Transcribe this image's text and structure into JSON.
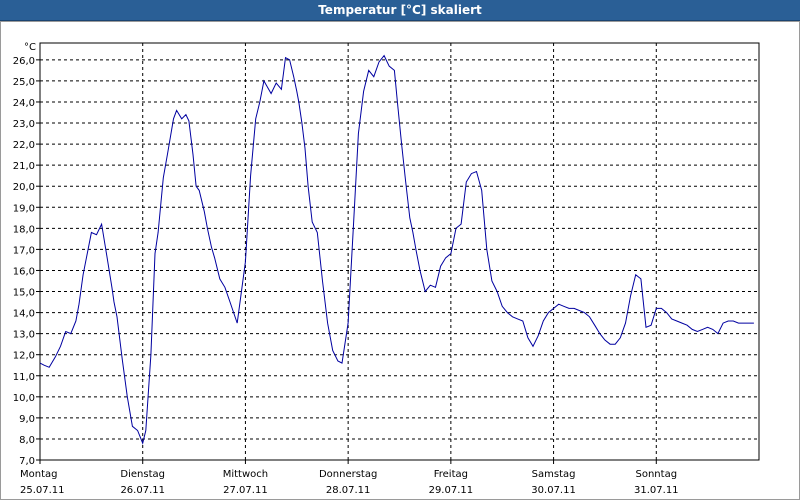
{
  "window": {
    "title": "Temperatur [°C] skaliert"
  },
  "chart_data": {
    "type": "line",
    "title": "Temperatur [°C] skaliert",
    "ylabel": "°C",
    "xlabel": "",
    "ylim": [
      7.0,
      26.8
    ],
    "xlim": [
      0,
      7
    ],
    "yticks": [
      "7,0",
      "8,0",
      "9,0",
      "10,0",
      "11,0",
      "12,0",
      "13,0",
      "14,0",
      "15,0",
      "16,0",
      "17,0",
      "18,0",
      "19,0",
      "20,0",
      "21,0",
      "22,0",
      "23,0",
      "24,0",
      "25,0",
      "26,0"
    ],
    "ytick_values": [
      7,
      8,
      9,
      10,
      11,
      12,
      13,
      14,
      15,
      16,
      17,
      18,
      19,
      20,
      21,
      22,
      23,
      24,
      25,
      26
    ],
    "days": [
      {
        "weekday": "Montag",
        "date": "25.07.11"
      },
      {
        "weekday": "Dienstag",
        "date": "26.07.11"
      },
      {
        "weekday": "Mittwoch",
        "date": "27.07.11"
      },
      {
        "weekday": "Donnerstag",
        "date": "28.07.11"
      },
      {
        "weekday": "Freitag",
        "date": "29.07.11"
      },
      {
        "weekday": "Samstag",
        "date": "30.07.11"
      },
      {
        "weekday": "Sonntag",
        "date": "31.07.11"
      }
    ],
    "grid": true,
    "line_color": "#0000a0",
    "series": [
      {
        "x": [
          0.0,
          0.04,
          0.09,
          0.15,
          0.2,
          0.25,
          0.3,
          0.35,
          0.38,
          0.42,
          0.5,
          0.55,
          0.6,
          0.65,
          0.7,
          0.72,
          0.75,
          0.8,
          0.85,
          0.9,
          0.95,
          1.0,
          1.03,
          1.08,
          1.12,
          1.15,
          1.2,
          1.24,
          1.3,
          1.33,
          1.38,
          1.42,
          1.45,
          1.49,
          1.52,
          1.55,
          1.6,
          1.63,
          1.67,
          1.7,
          1.75,
          1.8,
          1.85,
          1.92,
          2.0,
          2.05,
          2.1,
          2.14,
          2.18,
          2.25,
          2.3,
          2.35,
          2.39,
          2.43,
          2.47,
          2.5,
          2.52,
          2.55,
          2.58,
          2.61,
          2.65,
          2.7,
          2.75,
          2.8,
          2.85,
          2.9,
          2.94,
          3.0,
          3.05,
          3.1,
          3.15,
          3.2,
          3.25,
          3.3,
          3.35,
          3.4,
          3.45,
          3.48,
          3.52,
          3.56,
          3.6,
          3.63,
          3.66,
          3.7,
          3.75,
          3.8,
          3.85,
          3.9,
          3.95,
          4.0,
          4.05,
          4.1,
          4.15,
          4.2,
          4.25,
          4.3,
          4.35,
          4.4,
          4.45,
          4.5,
          4.55,
          4.6,
          4.65,
          4.7,
          4.75,
          4.8,
          4.85,
          4.9,
          4.95,
          5.0,
          5.05,
          5.1,
          5.15,
          5.2,
          5.25,
          5.3,
          5.35,
          5.4,
          5.45,
          5.5,
          5.55,
          5.6,
          5.65,
          5.7,
          5.75,
          5.8,
          5.85,
          5.9,
          5.95,
          6.0,
          6.05,
          6.1,
          6.15,
          6.2,
          6.25,
          6.3,
          6.35,
          6.4,
          6.45,
          6.5,
          6.55,
          6.6,
          6.65,
          6.7,
          6.75,
          6.8,
          6.85,
          6.9,
          6.95
        ],
        "y": [
          11.6,
          11.5,
          11.4,
          11.9,
          12.4,
          13.1,
          13.0,
          13.6,
          14.4,
          15.8,
          17.8,
          17.7,
          18.2,
          16.7,
          15.2,
          14.5,
          13.8,
          11.8,
          10.0,
          8.6,
          8.4,
          7.8,
          8.4,
          12.0,
          16.8,
          17.8,
          20.4,
          21.5,
          23.2,
          23.6,
          23.2,
          23.4,
          23.1,
          21.5,
          20.0,
          19.8,
          18.8,
          18.0,
          17.1,
          16.6,
          15.6,
          15.2,
          14.5,
          13.5,
          16.4,
          20.5,
          23.2,
          24.0,
          25.0,
          24.4,
          24.9,
          24.6,
          26.1,
          26.0,
          25.2,
          24.5,
          24.0,
          23.0,
          21.8,
          20.0,
          18.3,
          17.8,
          15.5,
          13.5,
          12.2,
          11.7,
          11.6,
          13.5,
          18.0,
          22.5,
          24.5,
          25.5,
          25.2,
          25.9,
          26.2,
          25.7,
          25.5,
          24.0,
          22.0,
          20.2,
          18.5,
          17.8,
          17.0,
          16.0,
          15.0,
          15.3,
          15.2,
          16.2,
          16.6,
          16.8,
          18.0,
          18.2,
          20.2,
          20.6,
          20.7,
          19.8,
          17.0,
          15.5,
          15.0,
          14.3,
          14.0,
          13.8,
          13.7,
          13.6,
          12.8,
          12.4,
          12.9,
          13.6,
          14.0,
          14.2,
          14.4,
          14.3,
          14.2,
          14.2,
          14.1,
          14.0,
          13.8,
          13.4,
          13.0,
          12.7,
          12.5,
          12.5,
          12.8,
          13.5,
          14.8,
          15.8,
          15.6,
          13.3,
          13.4,
          14.2,
          14.2,
          14.0,
          13.7,
          13.6,
          13.5,
          13.4,
          13.2,
          13.1,
          13.2,
          13.3,
          13.2,
          13.0,
          13.5,
          13.6,
          13.6,
          13.5,
          13.5,
          13.5,
          13.5
        ]
      }
    ]
  }
}
